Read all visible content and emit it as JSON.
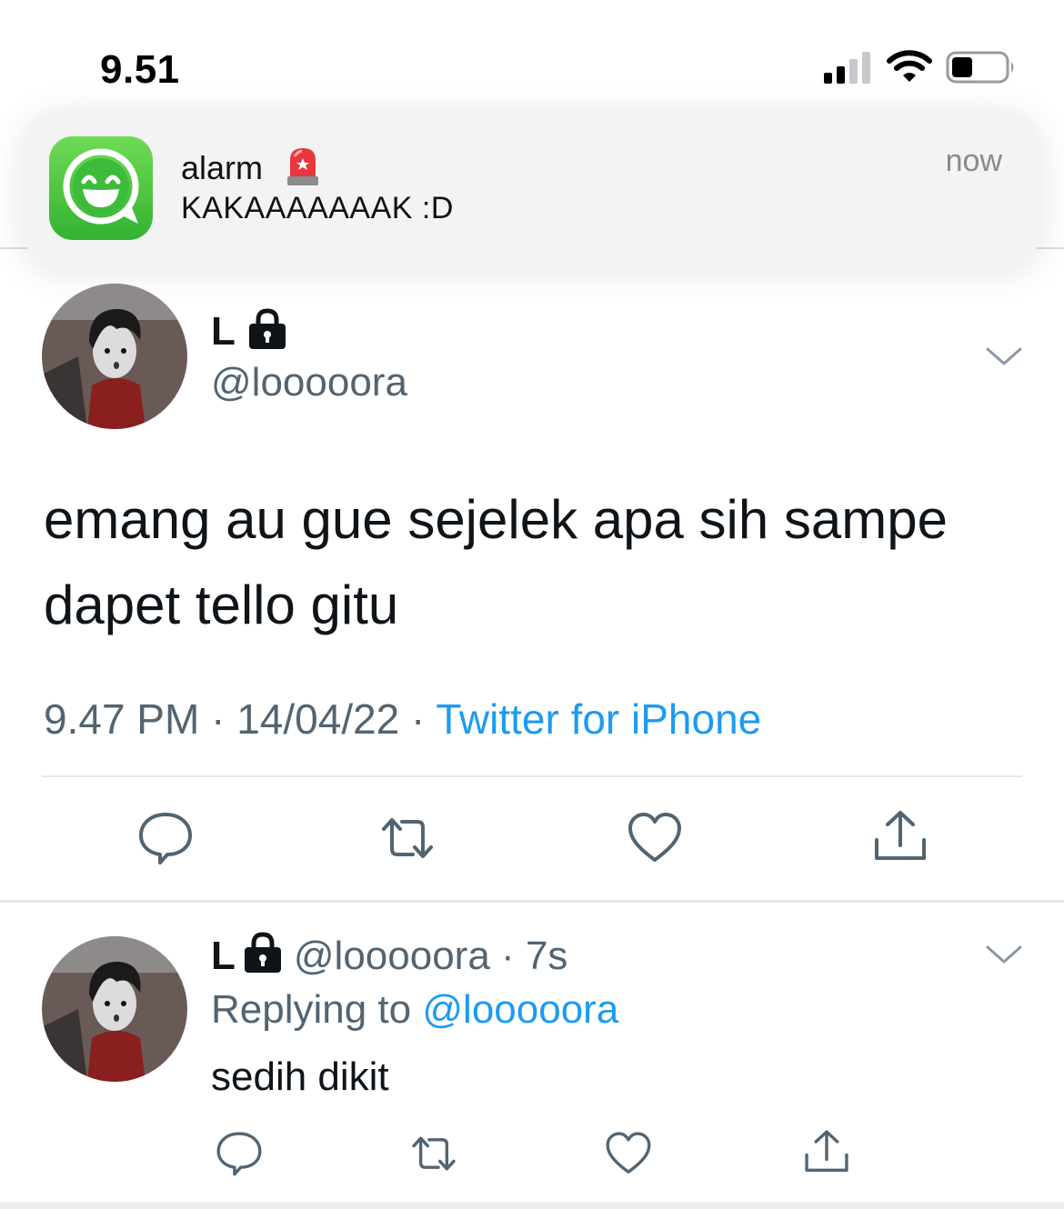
{
  "status_bar": {
    "time": "9.51",
    "signal_icon": "cellular-signal-icon",
    "wifi_icon": "wifi-icon",
    "battery_icon": "battery-icon",
    "battery_level": 0.35
  },
  "notification": {
    "app_icon": "whatsapp-icon",
    "title": "alarm",
    "title_emoji_icon": "police-siren-emoji",
    "body": "KAKAAAAAAAK :D",
    "time": "now"
  },
  "tweet": {
    "name": "L",
    "lock_icon": "lock-icon",
    "handle": "@looooora",
    "text": "emang au gue sejelek apa sih sampe dapet tello gitu",
    "time": "9.47 PM",
    "date": "14/04/22",
    "separator": "·",
    "source": "Twitter for iPhone",
    "actions": [
      "reply-icon",
      "retweet-icon",
      "like-icon",
      "share-icon"
    ]
  },
  "reply": {
    "name": "L",
    "handle": "@looooora",
    "separator": "·",
    "ago": "7s",
    "replying_label": "Replying to",
    "replying_to": "@looooora",
    "text": "sedih dikit"
  },
  "colors": {
    "link": "#1d9bf0",
    "secondary_text": "#536471",
    "app_green": "#34b233"
  }
}
